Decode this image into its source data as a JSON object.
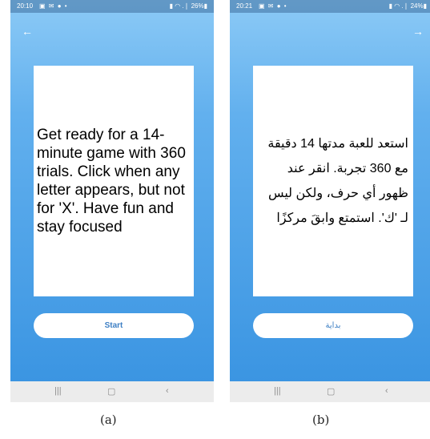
{
  "phone_a": {
    "status": {
      "time": "20:10",
      "icons": "▣ ✉ ● •",
      "right": "▮ ◠ .❘ 26%▮"
    },
    "back_arrow": "←",
    "card_text": "Get ready for a 14-minute game with 360 trials. Click when any letter appears, but not for 'X'. Have fun and stay focused",
    "button_label": "Start",
    "nav": {
      "recent": "|||",
      "home": "▢",
      "back": "‹"
    }
  },
  "phone_b": {
    "status": {
      "time": "20:21",
      "icons": "▣ ✉ ● •",
      "right": "▮ ◠ .❘ 24%▮"
    },
    "forward_arrow": "→",
    "card_text": "استعد للعبة مدتها 14 دقيقة مع 360 تجربة. انقر عند ظهور أي حرف، ولكن ليس لـ 'ك'. استمتع وابقَ مركزًا",
    "button_label": "بداية",
    "nav": {
      "recent": "|||",
      "home": "▢",
      "back": "‹"
    }
  },
  "captions": {
    "a": "(a)",
    "b": "(b)"
  }
}
